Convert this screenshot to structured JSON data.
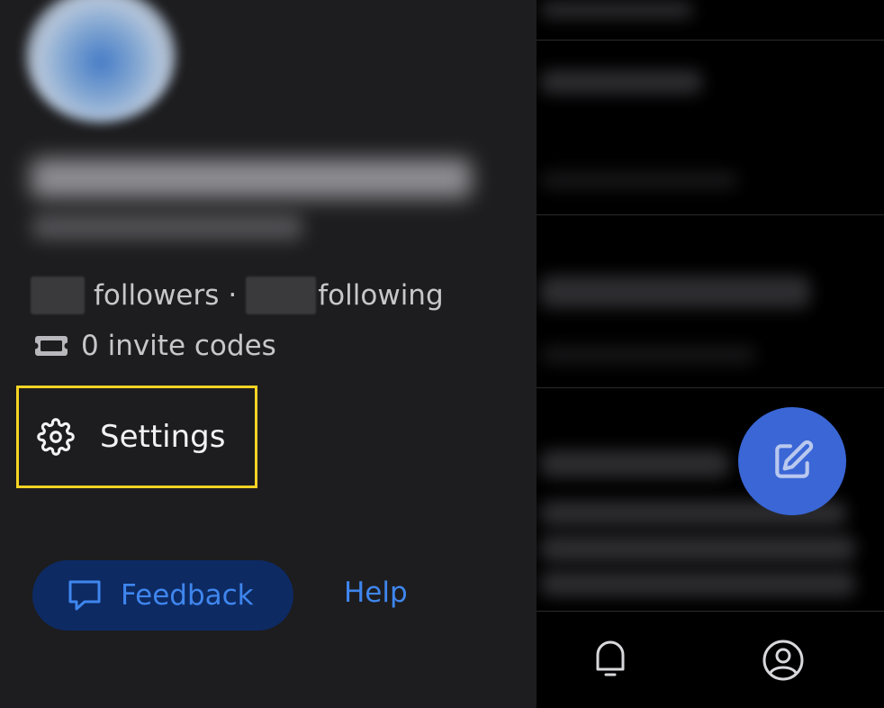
{
  "drawer": {
    "followers_label": "followers",
    "separator": "·",
    "following_label": "following",
    "invite_codes_text": "0 invite codes",
    "settings_label": "Settings",
    "feedback_label": "Feedback",
    "help_label": "Help"
  },
  "colors": {
    "drawer_bg": "#1d1d1f",
    "highlight": "#f5d425",
    "accent": "#3f86ee",
    "feedback_bg": "#0d2a63",
    "fab": "#3a66d6"
  },
  "icons": {
    "invite": "ticket-icon",
    "settings": "gear-icon",
    "feedback": "chat-bubble-icon",
    "compose": "compose-icon",
    "notifications": "bell-icon",
    "profile": "profile-icon"
  }
}
